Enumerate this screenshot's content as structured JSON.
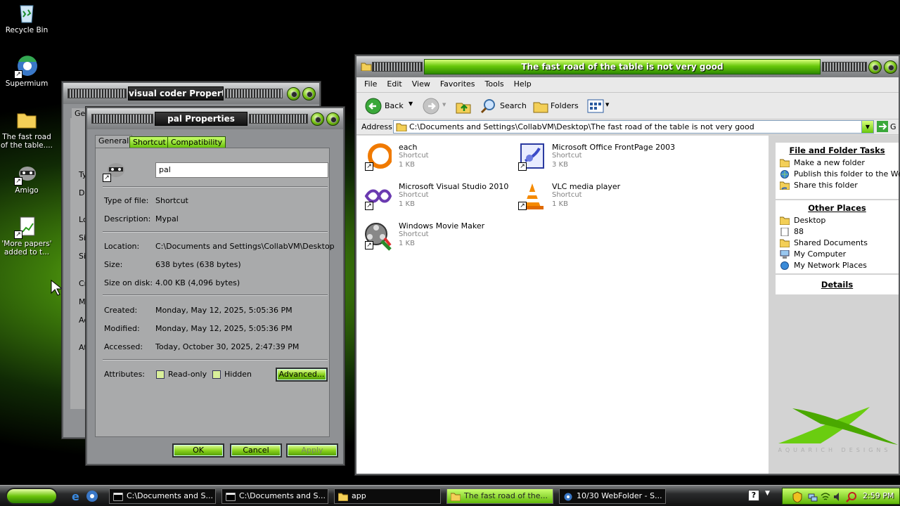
{
  "desktop": {
    "icons": [
      {
        "label": "Recycle Bin",
        "icon": "recycle-bin-icon"
      },
      {
        "label": "Supermium",
        "icon": "browser-icon"
      },
      {
        "label": "The fast road of the table....",
        "icon": "folder-icon"
      },
      {
        "label": "Amigo",
        "icon": "raccoon-icon"
      },
      {
        "label": "'More papers' added to t...",
        "icon": "document-chart-icon"
      }
    ]
  },
  "back_window": {
    "title": "visual coder Properties",
    "tab_fragment": "Gene",
    "label_fragments": [
      "Ty",
      "De",
      "Lo",
      "Si",
      "Si",
      "Cr",
      "Mo",
      "Ac",
      "At"
    ]
  },
  "properties": {
    "title": "pal Properties",
    "tabs": [
      "General",
      "Shortcut",
      "Compatibility"
    ],
    "name_value": "pal",
    "rows": [
      {
        "label": "Type of file:",
        "value": "Shortcut"
      },
      {
        "label": "Description:",
        "value": "Mypal"
      },
      {
        "label": "Location:",
        "value": "C:\\Documents and Settings\\CollabVM\\Desktop"
      },
      {
        "label": "Size:",
        "value": "638 bytes (638 bytes)"
      },
      {
        "label": "Size on disk:",
        "value": "4.00 KB (4,096 bytes)"
      },
      {
        "label": "Created:",
        "value": "Monday, May 12, 2025, 5:05:36 PM"
      },
      {
        "label": "Modified:",
        "value": "Monday, May 12, 2025, 5:05:36 PM"
      },
      {
        "label": "Accessed:",
        "value": "Today, October 30, 2025, 2:47:39 PM"
      }
    ],
    "attributes_label": "Attributes:",
    "readonly_label": "Read-only",
    "hidden_label": "Hidden",
    "advanced_label": "Advanced...",
    "ok_label": "OK",
    "cancel_label": "Cancel",
    "apply_label": "Apply"
  },
  "explorer": {
    "title": "The fast road of the table is not very good",
    "menu": [
      "File",
      "Edit",
      "View",
      "Favorites",
      "Tools",
      "Help"
    ],
    "toolbar": {
      "back": "Back",
      "search": "Search",
      "folders": "Folders"
    },
    "address_label": "Address",
    "address_value": "C:\\Documents and Settings\\CollabVM\\Desktop\\The fast road of the table is not very good",
    "go_label": "G",
    "files": [
      {
        "name": "each",
        "type": "Shortcut",
        "size": "1 KB",
        "icon": "orange-ring-icon"
      },
      {
        "name": "Microsoft Office FrontPage 2003",
        "type": "Shortcut",
        "size": "3 KB",
        "icon": "frontpage-icon"
      },
      {
        "name": "Microsoft Visual Studio 2010",
        "type": "Shortcut",
        "size": "1 KB",
        "icon": "visual-studio-icon"
      },
      {
        "name": "VLC media player",
        "type": "Shortcut",
        "size": "1 KB",
        "icon": "vlc-cone-icon"
      },
      {
        "name": "Windows Movie Maker",
        "type": "Shortcut",
        "size": "1 KB",
        "icon": "movie-maker-icon"
      }
    ],
    "tasks_title": "File and Folder Tasks",
    "tasks": [
      "Make a new folder",
      "Publish this folder to the Web",
      "Share this folder"
    ],
    "places_title": "Other Places",
    "places": [
      "Desktop",
      "88",
      "Shared Documents",
      "My Computer",
      "My Network Places"
    ],
    "details_title": "Details",
    "watermark": "AQUARICH DESIGNS"
  },
  "taskbar": {
    "tasks": [
      {
        "label": "C:\\Documents and S..."
      },
      {
        "label": "C:\\Documents and S..."
      },
      {
        "label": "app"
      },
      {
        "label": "The fast road of the..."
      },
      {
        "label": "10/30 WebFolder - S..."
      }
    ],
    "clock": "2:59 PM"
  },
  "colors": {
    "accent_green": "#7bc516",
    "panel_gray": "#a9aaab"
  }
}
